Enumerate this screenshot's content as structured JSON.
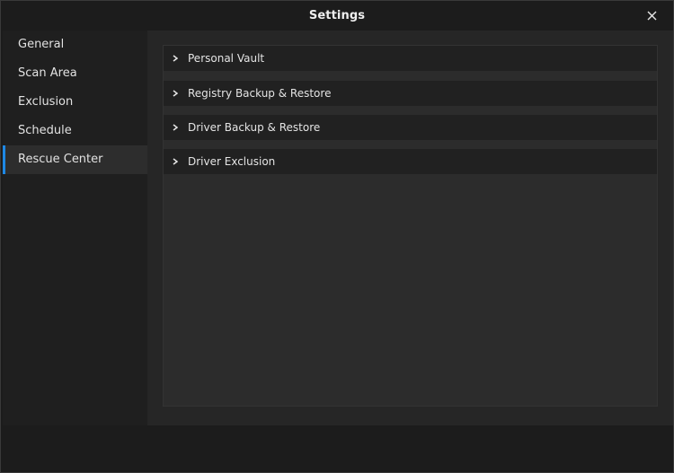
{
  "window": {
    "title": "Settings"
  },
  "sidebar": {
    "items": [
      {
        "label": "General",
        "active": false
      },
      {
        "label": "Scan Area",
        "active": false
      },
      {
        "label": "Exclusion",
        "active": false
      },
      {
        "label": "Schedule",
        "active": false
      },
      {
        "label": "Rescue Center",
        "active": true
      }
    ]
  },
  "sections": [
    {
      "label": "Personal Vault",
      "icon": "chevron-right-icon"
    },
    {
      "label": "Registry Backup & Restore",
      "icon": "chevron-right-icon"
    },
    {
      "label": "Driver Backup & Restore",
      "icon": "chevron-right-icon"
    },
    {
      "label": "Driver Exclusion",
      "icon": "chevron-right-icon"
    }
  ],
  "colors": {
    "accent": "#1e88e5",
    "background": "#1c1c1c",
    "panel": "#2c2c2c",
    "section": "#212121"
  }
}
